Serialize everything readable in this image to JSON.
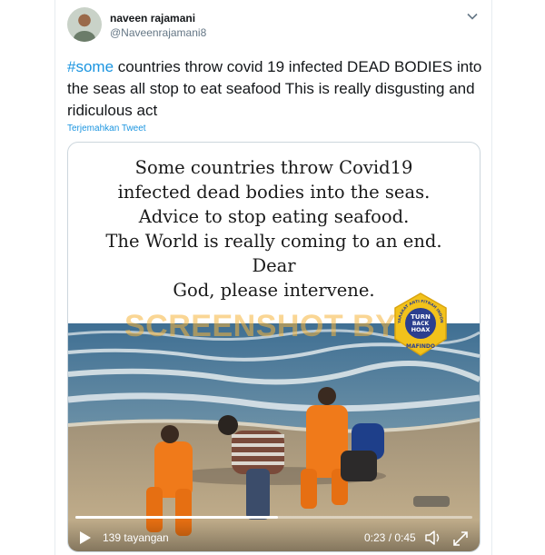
{
  "tweet": {
    "user": {
      "name": "naveen rajamani",
      "handle": "@Naveenrajamani8"
    },
    "hashtag": "#some",
    "text": " countries throw covid 19 infected DEAD BODIES into the seas all stop to eat seafood This is really disgusting and ridiculous act",
    "translate_label": "Terjemahkan Tweet"
  },
  "media": {
    "caption_lines": [
      "Some countries throw Covid19",
      "infected dead bodies into the seas.",
      "Advice to stop eating seafood.",
      "The World is really coming to an end.",
      "Dear",
      "God, please intervene."
    ],
    "watermark": "SCREENSHOT BY",
    "badge": {
      "ring_text": "MASYARAKAT ANTI FITNAH INDONESIA",
      "center_lines": [
        "TURN",
        "BACK",
        "HOAX"
      ],
      "bottom_text": "MAFINDO"
    },
    "video": {
      "views": "139 tayangan",
      "time": "0:23 / 0:45",
      "progress": 0.511
    }
  },
  "colors": {
    "link": "#1b95e0",
    "border": "#ccd6dd",
    "watermark": "#f5b43c",
    "badge": "#f2c21b"
  }
}
